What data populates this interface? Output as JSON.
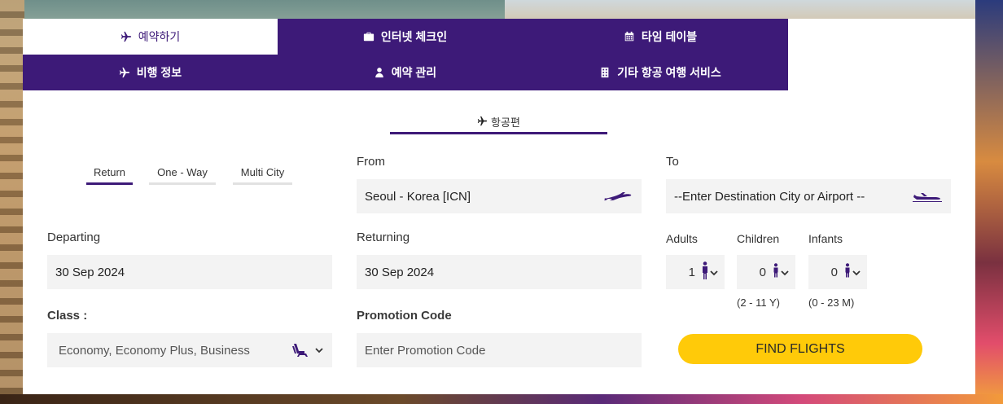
{
  "tabs": [
    {
      "label": "예약하기",
      "icon": "plane-icon",
      "active": true
    },
    {
      "label": "인터넷 체크인",
      "icon": "briefcase-icon",
      "active": false
    },
    {
      "label": "타임 테이블",
      "icon": "calendar-icon",
      "active": false
    },
    {
      "label": "비행 정보",
      "icon": "plane-icon",
      "active": false
    },
    {
      "label": "예약 관리",
      "icon": "user-icon",
      "active": false
    },
    {
      "label": "기타 항공 여행 서비스",
      "icon": "building-icon",
      "active": false
    }
  ],
  "subtab": {
    "label": "항공편",
    "icon": "plane-icon"
  },
  "trip_types": [
    {
      "label": "Return",
      "active": true
    },
    {
      "label": "One - Way",
      "active": false
    },
    {
      "label": "Multi City",
      "active": false
    }
  ],
  "from": {
    "label": "From",
    "value": "Seoul - Korea [ICN]",
    "icon": "plane-takeoff-icon"
  },
  "to": {
    "label": "To",
    "placeholder": "--Enter Destination City or Airport  --",
    "icon": "plane-landing-icon"
  },
  "departing": {
    "label": "Departing",
    "value": "30 Sep 2024"
  },
  "returning": {
    "label": "Returning",
    "value": "30 Sep 2024"
  },
  "passengers": {
    "adults": {
      "label": "Adults",
      "value": "1"
    },
    "children": {
      "label": "Children",
      "value": "0",
      "range": "(2 - 11 Y)"
    },
    "infants": {
      "label": "Infants",
      "value": "0",
      "range": "(0 - 23 M)"
    }
  },
  "class": {
    "label": "Class :",
    "value": "Economy, Economy Plus, Business",
    "icon": "seat-icon"
  },
  "promo": {
    "label": "Promotion Code",
    "placeholder": "Enter Promotion Code"
  },
  "find_button": "FIND FLIGHTS",
  "colors": {
    "brand_purple": "#3d1a78",
    "accent_yellow": "#ffca09",
    "field_bg": "#f3f3f3"
  }
}
